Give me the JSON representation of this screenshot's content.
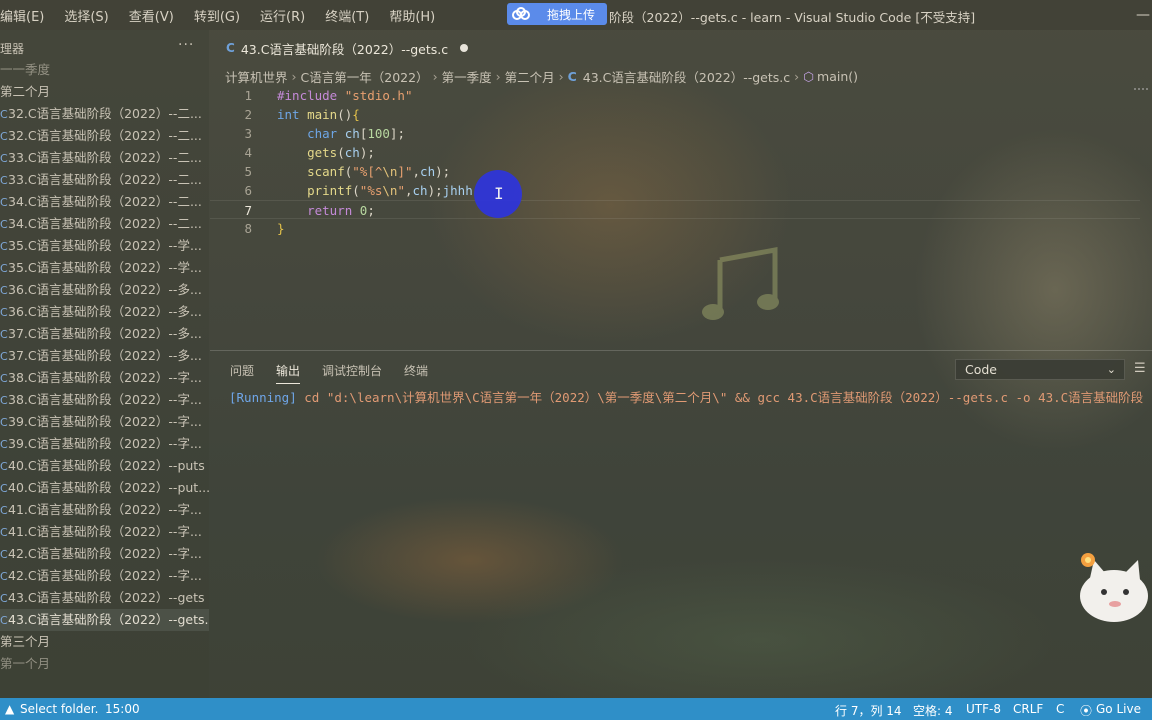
{
  "menubar": {
    "items": [
      "编辑(E)",
      "选择(S)",
      "查看(V)",
      "转到(G)",
      "运行(R)",
      "终端(T)",
      "帮助(H)"
    ],
    "upload_button": "拖拽上传",
    "window_title": "阶段（2022）--gets.c - learn - Visual Studio Code [不受支持]"
  },
  "sidebar": {
    "title": "理器",
    "more": "···",
    "tree": [
      {
        "label": "一一季度",
        "type": "folder",
        "partial": true
      },
      {
        "label": "第二个月",
        "type": "folder"
      },
      {
        "label": "32.C语言基础阶段（2022）--二...",
        "type": "file"
      },
      {
        "label": "32.C语言基础阶段（2022）--二...",
        "type": "file"
      },
      {
        "label": "33.C语言基础阶段（2022）--二...",
        "type": "file"
      },
      {
        "label": "33.C语言基础阶段（2022）--二...",
        "type": "file"
      },
      {
        "label": "34.C语言基础阶段（2022）--二...",
        "type": "file"
      },
      {
        "label": "34.C语言基础阶段（2022）--二...",
        "type": "file"
      },
      {
        "label": "35.C语言基础阶段（2022）--学...",
        "type": "file"
      },
      {
        "label": "35.C语言基础阶段（2022）--学...",
        "type": "file"
      },
      {
        "label": "36.C语言基础阶段（2022）--多...",
        "type": "file"
      },
      {
        "label": "36.C语言基础阶段（2022）--多...",
        "type": "file"
      },
      {
        "label": "37.C语言基础阶段（2022）--多...",
        "type": "file"
      },
      {
        "label": "37.C语言基础阶段（2022）--多...",
        "type": "file"
      },
      {
        "label": "38.C语言基础阶段（2022）--字...",
        "type": "file"
      },
      {
        "label": "38.C语言基础阶段（2022）--字...",
        "type": "file"
      },
      {
        "label": "39.C语言基础阶段（2022）--字...",
        "type": "file"
      },
      {
        "label": "39.C语言基础阶段（2022）--字...",
        "type": "file"
      },
      {
        "label": "40.C语言基础阶段（2022）--puts",
        "type": "file"
      },
      {
        "label": "40.C语言基础阶段（2022）--put...",
        "type": "file"
      },
      {
        "label": "41.C语言基础阶段（2022）--字...",
        "type": "file"
      },
      {
        "label": "41.C语言基础阶段（2022）--字...",
        "type": "file"
      },
      {
        "label": "42.C语言基础阶段（2022）--字...",
        "type": "file"
      },
      {
        "label": "42.C语言基础阶段（2022）--字...",
        "type": "file"
      },
      {
        "label": "43.C语言基础阶段（2022）--gets",
        "type": "file"
      },
      {
        "label": "43.C语言基础阶段（2022）--gets.c",
        "type": "file",
        "active": true
      },
      {
        "label": "第三个月",
        "type": "folder"
      },
      {
        "label": "第一个月",
        "type": "folder",
        "partial": true
      }
    ]
  },
  "tab": {
    "icon": "C",
    "label": "43.C语言基础阶段（2022）--gets.c"
  },
  "breadcrumb": {
    "items": [
      "计算机世界",
      "C语言第一年（2022）",
      "第一季度",
      "第二个月"
    ],
    "file_icon": "C",
    "file": "43.C语言基础阶段（2022）--gets.c",
    "symbol": "main()"
  },
  "editor": {
    "current_line": 7,
    "lines": [
      {
        "n": "1",
        "t": [
          [
            "kw-pp",
            "#include "
          ],
          [
            "str",
            "\"stdio.h\""
          ]
        ]
      },
      {
        "n": "2",
        "t": [
          [
            "kw-type",
            "int "
          ],
          [
            "fn",
            "main"
          ],
          [
            "",
            "()"
          ],
          [
            "brace",
            "{"
          ]
        ]
      },
      {
        "n": "3",
        "t": [
          [
            "",
            "    "
          ],
          [
            "kw-type",
            "char "
          ],
          [
            "var",
            "ch"
          ],
          [
            "",
            "["
          ],
          [
            "num",
            "100"
          ],
          [
            "",
            "];"
          ]
        ]
      },
      {
        "n": "4",
        "t": [
          [
            "",
            "    "
          ],
          [
            "fn",
            "gets"
          ],
          [
            "",
            "("
          ],
          [
            "var",
            "ch"
          ],
          [
            "",
            ");"
          ]
        ]
      },
      {
        "n": "5",
        "t": [
          [
            "",
            "    "
          ],
          [
            "fn",
            "scanf"
          ],
          [
            "",
            "("
          ],
          [
            "str",
            "\"%[^"
          ],
          [
            "esc",
            "\\n"
          ],
          [
            "str",
            "]\""
          ],
          [
            "",
            ","
          ],
          [
            "var",
            "ch"
          ],
          [
            "",
            ");"
          ]
        ]
      },
      {
        "n": "6",
        "t": [
          [
            "",
            "    "
          ],
          [
            "fn",
            "printf"
          ],
          [
            "",
            "("
          ],
          [
            "str",
            "\"%s"
          ],
          [
            "esc",
            "\\n"
          ],
          [
            "str",
            "\""
          ],
          [
            "",
            ","
          ],
          [
            "var",
            "ch"
          ],
          [
            "",
            ");"
          ],
          [
            "var",
            "jhhh"
          ]
        ]
      },
      {
        "n": "7",
        "t": [
          [
            "",
            "    "
          ],
          [
            "kw-ret",
            "return "
          ],
          [
            "num",
            "0"
          ],
          [
            "",
            ";"
          ]
        ]
      },
      {
        "n": "8",
        "t": [
          [
            "brace",
            "}"
          ]
        ]
      }
    ]
  },
  "panel": {
    "tabs": [
      "问题",
      "输出",
      "调试控制台",
      "终端"
    ],
    "active_tab": "输出",
    "output_channel": "Code",
    "output_running": "[Running]",
    "output_command": " cd \"d:\\learn\\计算机世界\\C语言第一年（2022）\\第一季度\\第二个月\\\" && gcc 43.C语言基础阶段（2022）--gets.c -o 43.C语言基础阶段"
  },
  "statusbar": {
    "left": "Select folder.",
    "time": "15:00",
    "position": "行 7，列 14",
    "spaces": "空格: 4",
    "encoding": "UTF-8",
    "eol": "CRLF",
    "language": "C",
    "golive": "Go Live"
  },
  "colors": {
    "statusbar": "#2f8fc8",
    "upload": "#5b8bea",
    "cursor_highlight": "#2e34dc"
  }
}
